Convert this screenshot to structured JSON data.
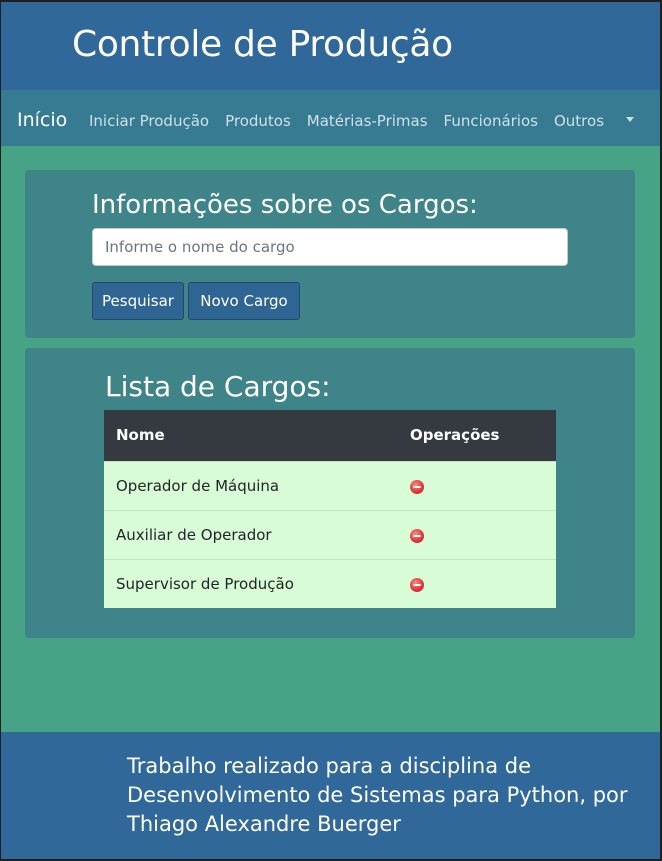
{
  "header": {
    "title": "Controle de Produção"
  },
  "navbar": {
    "brand": "Início",
    "links": [
      "Iniciar Produção",
      "Produtos",
      "Matérias-Primas",
      "Funcionários",
      "Outros"
    ]
  },
  "search_section": {
    "heading": "Informações sobre os Cargos:",
    "input_placeholder": "Informe o nome do cargo",
    "input_value": "",
    "search_button": "Pesquisar",
    "new_button": "Novo Cargo"
  },
  "list_section": {
    "heading": "Lista de Cargos:",
    "columns": [
      "Nome",
      "Operações"
    ],
    "rows": [
      {
        "name": "Operador de Máquina",
        "operation_icon": "delete-icon"
      },
      {
        "name": "Auxiliar de Operador",
        "operation_icon": "delete-icon"
      },
      {
        "name": "Supervisor de Produção",
        "operation_icon": "delete-icon"
      }
    ]
  },
  "footer": {
    "text": "Trabalho realizado para a disciplina de Desenvolvimento de Sistemas para Python, por Thiago Alexandre Buerger"
  },
  "colors": {
    "header_bg": "#306899",
    "navbar_bg": "#367b91",
    "page_bg": "#46a385",
    "card_bg": "#3e8489",
    "button_bg": "#2f6592",
    "table_header_bg": "#343a40",
    "table_row_bg": "#d8fcd5"
  }
}
